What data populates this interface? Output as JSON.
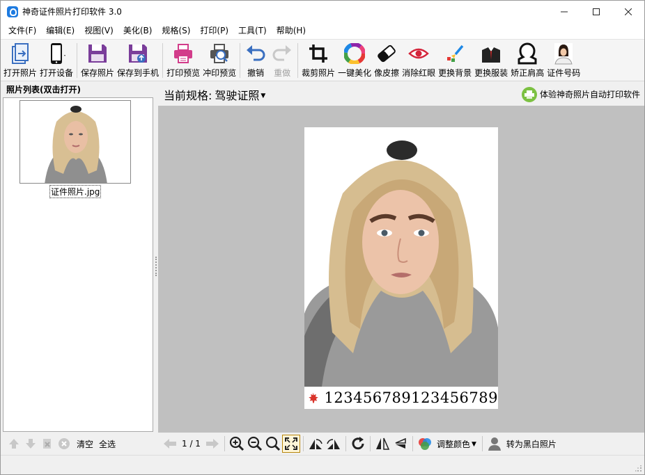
{
  "window": {
    "title": "神奇证件照片打印软件 3.0",
    "controls": {
      "minimize": "─",
      "maximize": "☐",
      "close": "✕"
    }
  },
  "menu": [
    "文件(F)",
    "编辑(E)",
    "视图(V)",
    "美化(B)",
    "规格(S)",
    "打印(P)",
    "工具(T)",
    "帮助(H)"
  ],
  "toolbar": {
    "open_photo": "打开照片",
    "open_device": "打开设备",
    "save_photo": "保存照片",
    "save_to_phone": "保存到手机",
    "print_preview": "打印预览",
    "develop_preview": "冲印预览",
    "undo": "撤销",
    "redo": "重做",
    "crop": "裁剪照片",
    "one_click_beautify": "一键美化",
    "eraser": "像皮擦",
    "red_eye": "消除红眼",
    "change_background": "更换背景",
    "change_clothes": "更换服装",
    "fix_shoulders": "矫正肩高",
    "id_number": "证件号码"
  },
  "left_panel": {
    "header": "照片列表(双击打开)",
    "items": [
      {
        "filename": "证件照片.jpg"
      }
    ],
    "clear_label": "清空",
    "select_all_label": "全选"
  },
  "main": {
    "spec_label": "当前规格:",
    "spec_value": "驾驶证照",
    "promo_text": "体验神奇照片自动打印软件",
    "id_number": "123456789123456789"
  },
  "bottom_bar": {
    "page_indicator": "1 / 1",
    "adjust_color": "调整颜色",
    "to_grayscale": "转为黑白照片"
  },
  "colors": {
    "accent_blue": "#1e7be0",
    "canvas_gray": "#c0c0c0",
    "save_purple": "#7a3d9a",
    "print_pink": "#d23c8a",
    "undo_blue": "#3a6fc0",
    "red_eye": "#d4243a"
  }
}
